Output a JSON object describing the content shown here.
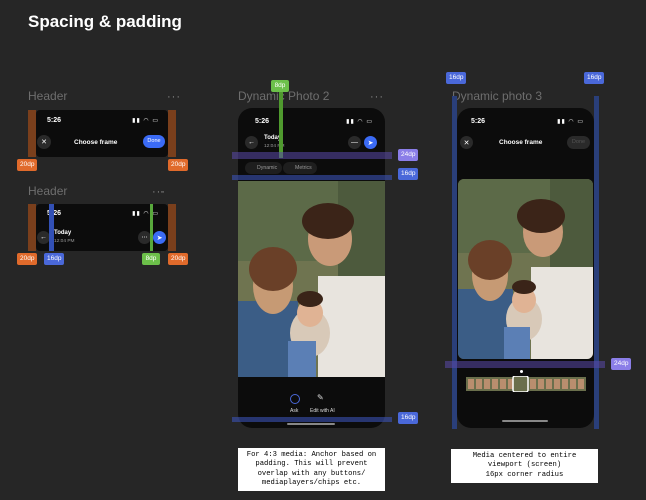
{
  "page_title": "Spacing & padding",
  "sections": {
    "header1": {
      "label": "Header",
      "dots": "···"
    },
    "header2": {
      "label": "Header",
      "dots": "···"
    },
    "dyn2": {
      "label": "Dynamic Photo 2",
      "dots": "···"
    },
    "dyn3": {
      "label": "Dynamic photo 3",
      "dots": "···"
    }
  },
  "header1": {
    "time": "5:26",
    "title": "Choose frame",
    "done": "Done",
    "badge_left": "20dp",
    "badge_right": "20dp"
  },
  "header2": {
    "time": "5:26",
    "title": "Today",
    "subtitle": "12:04 PM",
    "badge_left": "20dp",
    "badge_16": "16dp",
    "badge_8": "8dp",
    "badge_right": "20dp"
  },
  "dyn2": {
    "time": "5:26",
    "title": "Today",
    "subtitle": "12:04 PM",
    "chips": [
      "Dynamic",
      "Metrics"
    ],
    "badge_top": "8dp",
    "badge_24": "24dp",
    "badge_16a": "16dp",
    "badge_16b": "16dp",
    "ask": "Ask",
    "edit": "Edit with AI",
    "note": "For 4:3 media: Anchor based on padding. This will prevent overlap with any buttons/ mediaplayers/chips etc."
  },
  "dyn3": {
    "time": "5:26",
    "title": "Choose frame",
    "done": "Done",
    "badge_tl": "16dp",
    "badge_tr": "16dp",
    "badge_24": "24dp",
    "note": "Media centered to entire\nviewport (screen)\n16px corner radius"
  },
  "icons": [
    "close-icon",
    "send-icon",
    "back-icon",
    "more-icon",
    "minus-icon",
    "sparkle-icon",
    "pen-icon"
  ],
  "colors": {
    "orange": "#e06a2b",
    "blue": "#4a68d9",
    "green": "#6cc04a",
    "purple": "#8b7ee8",
    "accent": "#3b6bf5"
  }
}
